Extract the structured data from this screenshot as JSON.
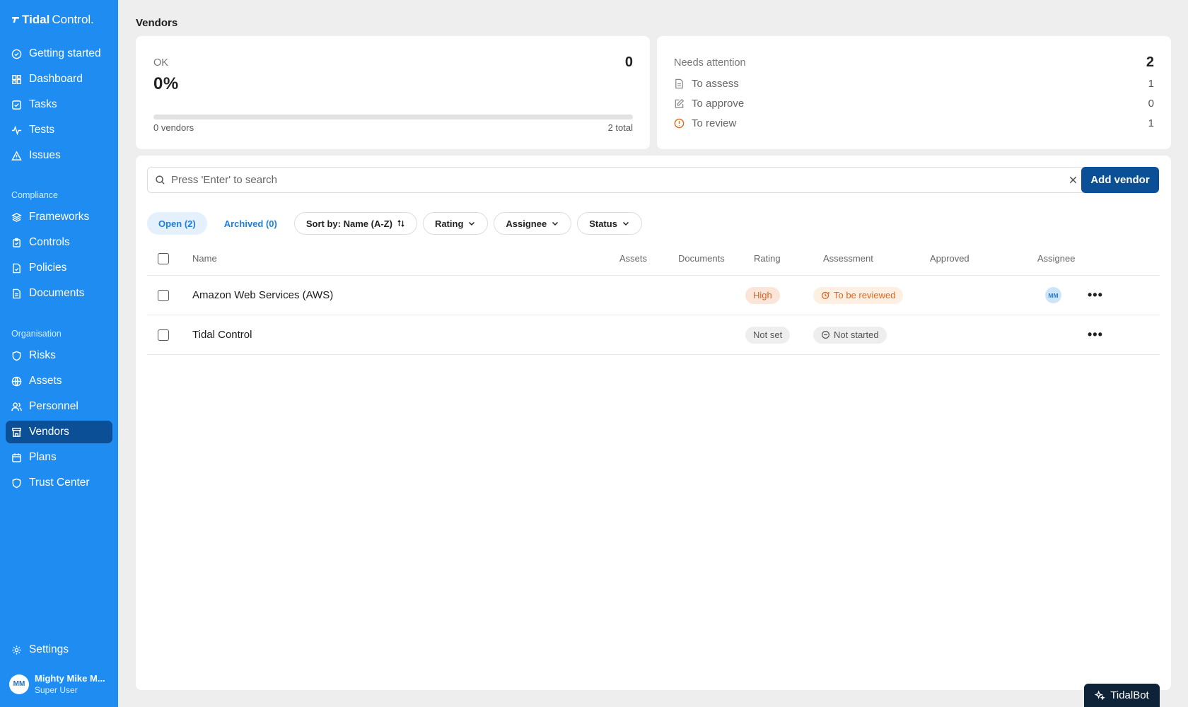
{
  "app": {
    "logo_bold": "Tidal",
    "logo_light": "Control."
  },
  "sidebar": {
    "main_items": [
      {
        "label": "Getting started",
        "icon": "check-circle-icon"
      },
      {
        "label": "Dashboard",
        "icon": "dashboard-icon"
      },
      {
        "label": "Tasks",
        "icon": "tasks-icon"
      },
      {
        "label": "Tests",
        "icon": "pulse-icon"
      },
      {
        "label": "Issues",
        "icon": "warning-icon"
      }
    ],
    "compliance_label": "Compliance",
    "compliance_items": [
      {
        "label": "Frameworks",
        "icon": "layers-icon"
      },
      {
        "label": "Controls",
        "icon": "clipboard-icon"
      },
      {
        "label": "Policies",
        "icon": "policy-doc-icon"
      },
      {
        "label": "Documents",
        "icon": "document-icon"
      }
    ],
    "organisation_label": "Organisation",
    "organisation_items": [
      {
        "label": "Risks",
        "icon": "shield-alert-icon"
      },
      {
        "label": "Assets",
        "icon": "globe-icon"
      },
      {
        "label": "Personnel",
        "icon": "users-icon"
      },
      {
        "label": "Vendors",
        "icon": "store-icon",
        "active": true
      },
      {
        "label": "Plans",
        "icon": "calendar-icon"
      },
      {
        "label": "Trust Center",
        "icon": "shield-icon"
      }
    ],
    "settings_label": "Settings",
    "user": {
      "initials": "MM",
      "name": "Mighty Mike M...",
      "role": "Super User"
    }
  },
  "page": {
    "title": "Vendors"
  },
  "ok_card": {
    "label": "OK",
    "count": "0",
    "percent": "0%",
    "progress_fraction": 0,
    "footer_left": "0 vendors",
    "footer_right": "2 total"
  },
  "needs_attention": {
    "label": "Needs attention",
    "count": "2",
    "rows": [
      {
        "label": "To assess",
        "value": "1",
        "icon": "document-icon"
      },
      {
        "label": "To approve",
        "value": "0",
        "icon": "edit-icon"
      },
      {
        "label": "To review",
        "value": "1",
        "icon": "alert-circle-icon"
      }
    ]
  },
  "search": {
    "placeholder": "Press 'Enter' to search",
    "value": ""
  },
  "add_vendor_label": "Add vendor",
  "filters": {
    "tab_open": "Open (2)",
    "tab_archived": "Archived (0)",
    "sort": "Sort by: Name (A-Z)",
    "rating": "Rating",
    "assignee": "Assignee",
    "status": "Status"
  },
  "table": {
    "headers": {
      "name": "Name",
      "assets": "Assets",
      "documents": "Documents",
      "rating": "Rating",
      "assessment": "Assessment",
      "approved": "Approved",
      "assignee": "Assignee"
    },
    "rows": [
      {
        "name": "Amazon Web Services (AWS)",
        "rating": "High",
        "assessment": "To be reviewed",
        "assignee": "MM"
      },
      {
        "name": "Tidal Control",
        "rating": "Not set",
        "assessment": "Not started",
        "assignee": ""
      }
    ]
  },
  "tidalbot_label": "TidalBot",
  "colors": {
    "sidebar": "#1e8cf0",
    "active_nav": "#0b4f97",
    "primary_button": "#0b4f97",
    "warning": "#e0651c"
  }
}
